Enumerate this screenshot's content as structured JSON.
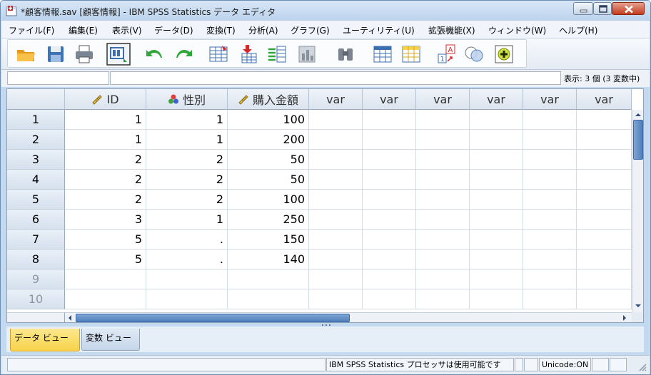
{
  "window": {
    "title": "*顧客情報.sav [顧客情報] - IBM SPSS Statistics データ エディタ"
  },
  "menu": [
    "ファイル(F)",
    "編集(E)",
    "表示(V)",
    "データ(D)",
    "変換(T)",
    "分析(A)",
    "グラフ(G)",
    "ユーティリティ(U)",
    "拡張機能(X)",
    "ウィンドウ(W)",
    "ヘルプ(H)"
  ],
  "toolbar": [
    {
      "icon": "open-folder-icon"
    },
    {
      "icon": "save-disk-icon"
    },
    {
      "icon": "print-icon"
    },
    {
      "icon": "recall-dialog-icon"
    },
    {
      "icon": "undo-icon"
    },
    {
      "icon": "redo-icon"
    },
    {
      "icon": "goto-case-icon"
    },
    {
      "icon": "goto-variable-icon"
    },
    {
      "icon": "variables-icon"
    },
    {
      "icon": "run-descriptives-icon"
    },
    {
      "icon": "find-binoculars-icon"
    },
    {
      "icon": "insert-cases-icon"
    },
    {
      "icon": "insert-variable-icon"
    },
    {
      "icon": "split-file-icon"
    },
    {
      "icon": "weight-cases-icon"
    },
    {
      "icon": "select-cases-icon"
    },
    {
      "icon": "value-labels-icon"
    }
  ],
  "cellbar": {
    "cell_ref": "",
    "cell_value": "",
    "display_info": "表示: 3 個 (3 変数中)"
  },
  "grid": {
    "columns": [
      {
        "label": "ID",
        "icon": "scale-ruler-icon"
      },
      {
        "label": "性別",
        "icon": "nominal-circles-icon"
      },
      {
        "label": "購入金額",
        "icon": "scale-ruler-icon"
      },
      {
        "label": "var",
        "icon": ""
      },
      {
        "label": "var",
        "icon": ""
      },
      {
        "label": "var",
        "icon": ""
      },
      {
        "label": "var",
        "icon": ""
      },
      {
        "label": "var",
        "icon": ""
      },
      {
        "label": "var",
        "icon": ""
      }
    ],
    "rows": [
      {
        "num": "1",
        "cells": [
          "1",
          "1",
          "100"
        ]
      },
      {
        "num": "2",
        "cells": [
          "1",
          "1",
          "200"
        ]
      },
      {
        "num": "3",
        "cells": [
          "2",
          "2",
          "50"
        ]
      },
      {
        "num": "4",
        "cells": [
          "2",
          "2",
          "50"
        ]
      },
      {
        "num": "5",
        "cells": [
          "2",
          "2",
          "100"
        ]
      },
      {
        "num": "6",
        "cells": [
          "3",
          "1",
          "250"
        ]
      },
      {
        "num": "7",
        "cells": [
          "5",
          ".",
          "150"
        ]
      },
      {
        "num": "8",
        "cells": [
          "5",
          ".",
          "140"
        ]
      },
      {
        "num": "9",
        "cells": [
          "",
          "",
          ""
        ]
      },
      {
        "num": "10",
        "cells": [
          "",
          "",
          ""
        ]
      }
    ]
  },
  "tabs": [
    {
      "label": "データ ビュー",
      "active": true
    },
    {
      "label": "変数 ビュー",
      "active": false
    }
  ],
  "statusbar": {
    "processor": "IBM SPSS Statistics プロセッサは使用可能です",
    "unicode": "Unicode:ON"
  },
  "colors": {
    "active_tab": "#f7d24a",
    "window_frame": "#c3d9f0",
    "scroll_thumb": "#4f7fbd"
  }
}
